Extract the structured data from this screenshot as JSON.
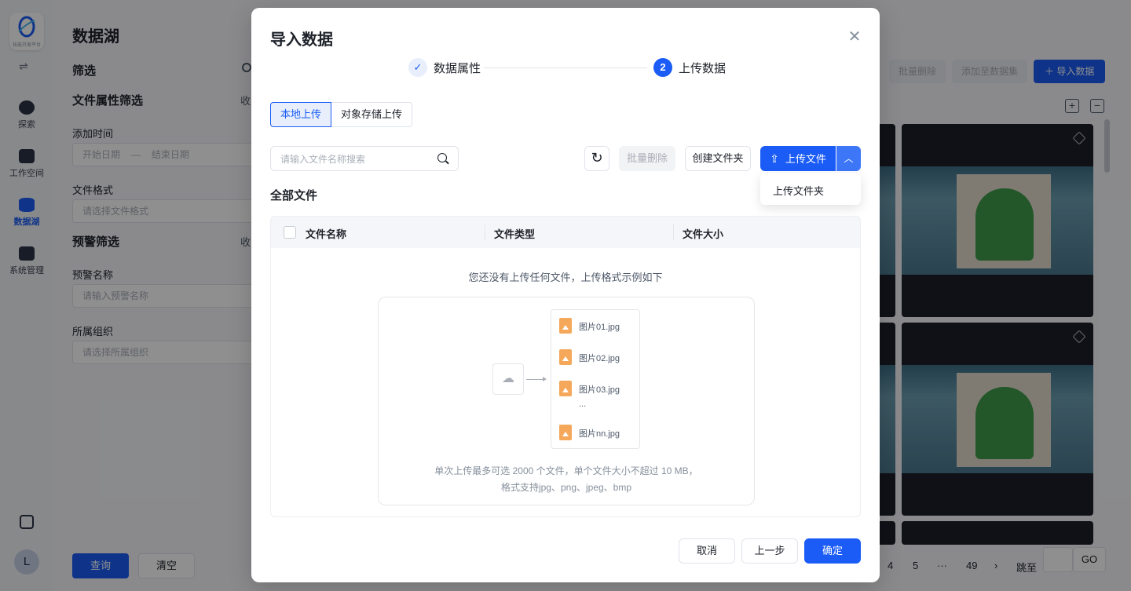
{
  "app": {
    "logo_text": "技能开发平台",
    "nav": [
      {
        "label": "探索"
      },
      {
        "label": "工作空间"
      },
      {
        "label": "数据湖"
      },
      {
        "label": "系统管理"
      }
    ],
    "avatar_initial": "L"
  },
  "filter_panel": {
    "title": "数据湖",
    "filter_heading": "筛选",
    "file_attr_heading": "文件属性筛选",
    "collapse": "收",
    "add_time_label": "添加时间",
    "start_date": "开始日期",
    "date_sep": "—",
    "end_date": "结束日期",
    "format_label": "文件格式",
    "format_placeholder": "请选择文件格式",
    "alert_heading": "预警筛选",
    "alert_name_label": "预警名称",
    "alert_name_placeholder": "请输入预警名称",
    "org_label": "所属组织",
    "org_placeholder": "请选择所属组织",
    "query_button": "查询",
    "clear_button": "清空"
  },
  "main": {
    "batch_delete": "批量删除",
    "add_to_dataset": "添加至数据集",
    "import_data": "导入数据",
    "import_icon": "plus-icon",
    "pagination": {
      "p4": "4",
      "p5": "5",
      "ellipsis": "···",
      "last": "49",
      "jump_label": "跳至",
      "go": "GO"
    }
  },
  "modal": {
    "title": "导入数据",
    "steps": [
      {
        "label": "数据属性",
        "status": "done",
        "marker": "✓"
      },
      {
        "label": "上传数据",
        "status": "current",
        "marker": "2"
      }
    ],
    "tabs": [
      {
        "label": "本地上传",
        "active": true
      },
      {
        "label": "对象存储上传",
        "active": false
      }
    ],
    "search_placeholder": "请输入文件名称搜索",
    "toolbar": {
      "refresh_icon": "refresh-icon",
      "batch_delete": "批量删除",
      "create_folder": "创建文件夹",
      "upload_file": "上传文件",
      "upload_menu": [
        "上传文件夹"
      ]
    },
    "section_title": "全部文件",
    "table": {
      "columns": [
        "文件名称",
        "文件类型",
        "文件大小"
      ],
      "empty_message": "您还没有上传任何文件，上传格式示例如下"
    },
    "example": {
      "files": [
        "图片01.jpg",
        "图片02.jpg",
        "图片03.jpg",
        "图片nn.jpg"
      ],
      "ellipsis": "...",
      "note_line1": "单次上传最多可选 2000 个文件，单个文件大小不超过 10 MB，",
      "note_line2": "格式支持jpg、png、jpeg、bmp"
    },
    "footer": {
      "cancel": "取消",
      "prev": "上一步",
      "confirm": "确定"
    }
  },
  "colors": {
    "primary": "#1a5cf5",
    "file_icon": "#f5a85a"
  }
}
